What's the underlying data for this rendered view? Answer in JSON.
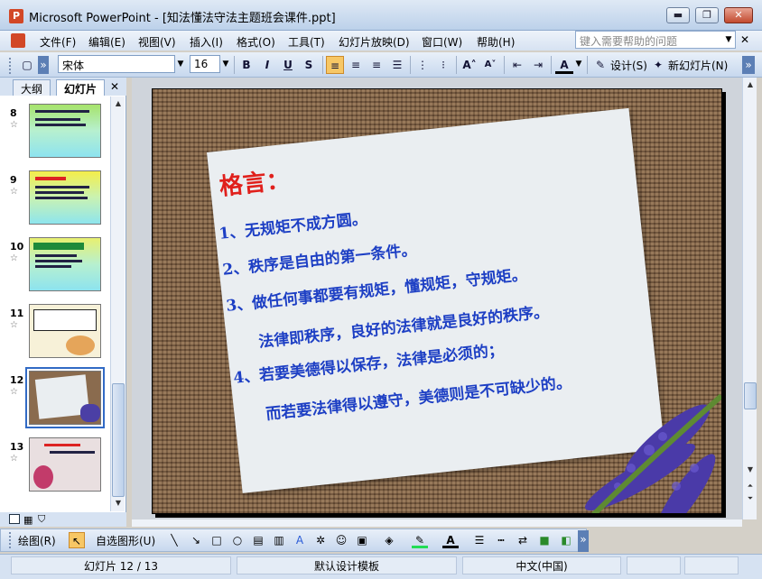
{
  "window": {
    "title": "Microsoft PowerPoint - [知法懂法守法主题班会课件.ppt]",
    "minimize": "▬",
    "restore": "❐",
    "close": "✕"
  },
  "menu": {
    "items": [
      "文件(F)",
      "编辑(E)",
      "视图(V)",
      "插入(I)",
      "格式(O)",
      "工具(T)",
      "幻灯片放映(D)",
      "窗口(W)",
      "帮助(H)"
    ],
    "help_placeholder": "键入需要帮助的问题",
    "doc_close": "✕"
  },
  "format_toolbar": {
    "font": "宋体",
    "size": "16",
    "bold": "B",
    "italic": "I",
    "underline": "U",
    "shadow": "S",
    "design": "设计(S)",
    "new_slide": "新幻灯片(N)"
  },
  "left_pane": {
    "tabs": [
      "大纲",
      "幻灯片"
    ],
    "close": "✕",
    "slide_numbers": [
      "8",
      "9",
      "10",
      "11",
      "12",
      "13"
    ],
    "selected_slide": "12"
  },
  "slide": {
    "title": "格言：",
    "lines": [
      "1、无规矩不成方圆。",
      "2、秩序是自由的第一条件。",
      "3、做任何事都要有规矩，懂规矩，守规矩。",
      "法律即秩序，良好的法律就是良好的秩序。",
      "4、若要美德得以保存，法律是必须的；",
      "而若要法律得以遵守，美德则是不可缺少的。"
    ]
  },
  "draw_toolbar": {
    "draw": "绘图(R)",
    "autoshapes": "自选图形(U)"
  },
  "status": {
    "slide": "幻灯片 12 / 13",
    "template": "默认设计模板",
    "language": "中文(中国)"
  },
  "colors": {
    "title_red": "#e0201c",
    "text_blue": "#1d3fc4",
    "selection": "#316ac5"
  }
}
